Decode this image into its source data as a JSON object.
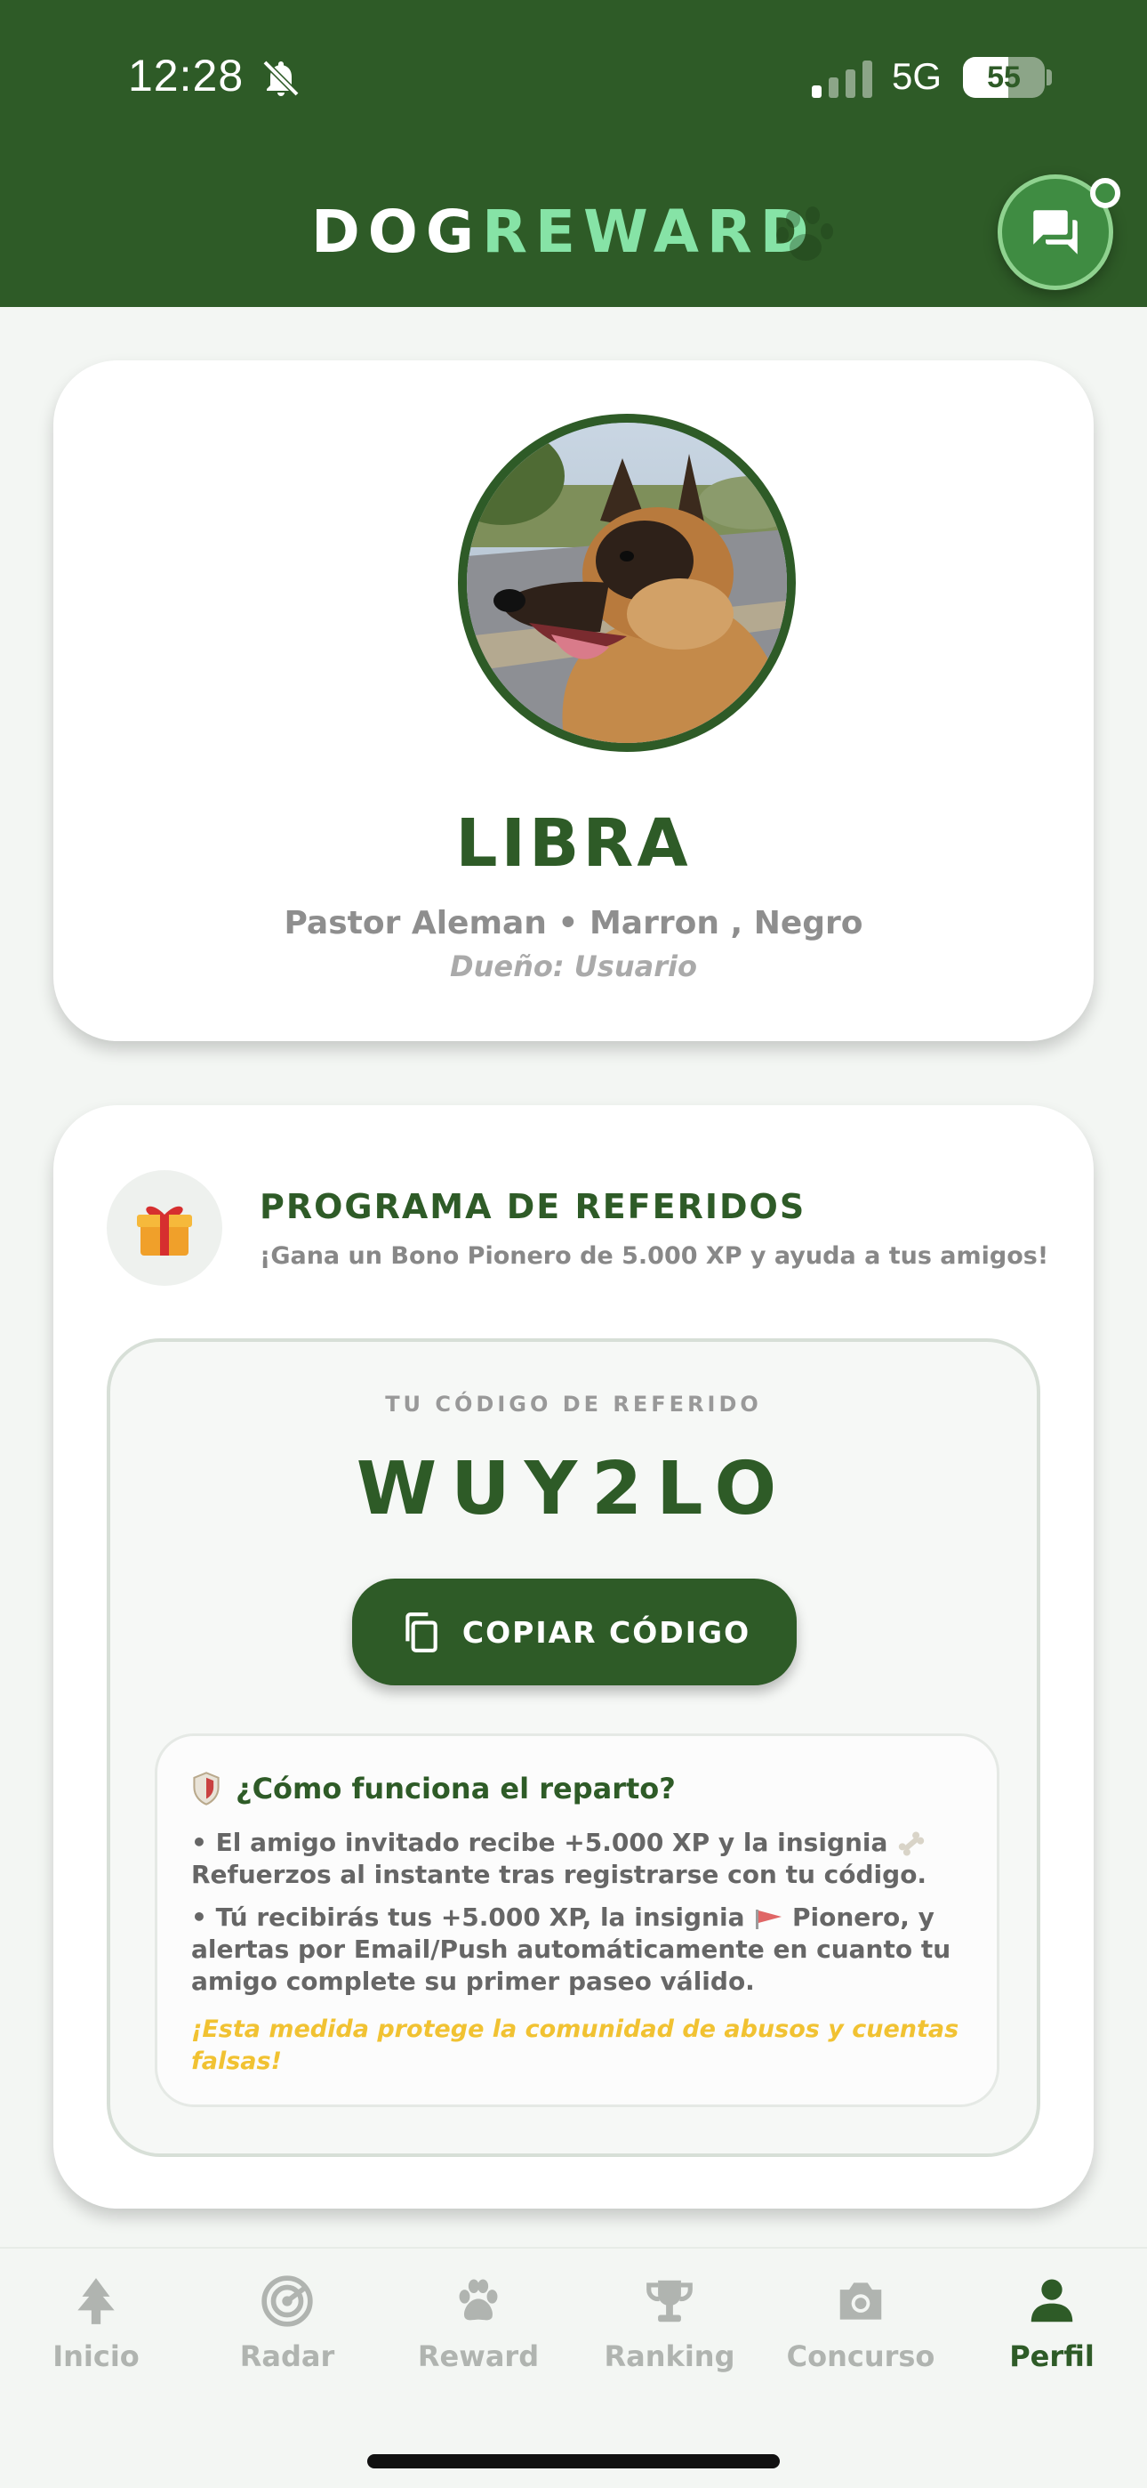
{
  "status_bar": {
    "time": "12:28",
    "network": "5G",
    "battery": "55",
    "battery_level": 0.55
  },
  "header": {
    "logo_part1": "DOG",
    "logo_part2": "REWARD"
  },
  "profile": {
    "name": "LIBRA",
    "breed_colors": "Pastor Aleman • Marron , Negro",
    "owner": "Dueño: Usuario"
  },
  "referral": {
    "title": "PROGRAMA DE REFERIDOS",
    "subtitle": "¡Gana un Bono Pionero de 5.000 XP y ayuda a tus amigos!",
    "code_label": "TU CÓDIGO DE REFERIDO",
    "code": "WUY2LO",
    "copy_label": "COPIAR CÓDIGO",
    "info_title": "¿Cómo funciona el reparto?",
    "info_p1_a": "• El amigo invitado recibe +5.000 XP y la insignia",
    "info_p1_b": "Refuerzos al instante tras registrarse con tu código.",
    "info_p2_a": "• Tú recibirás tus +5.000 XP, la insignia",
    "info_p2_b": "Pionero, y alertas por Email/Push automáticamente en cuanto tu amigo complete su primer paseo válido.",
    "warning": "¡Esta medida protege la comunidad de abusos y cuentas falsas!"
  },
  "nav": {
    "items": [
      {
        "label": "Inicio",
        "icon": "tree-icon"
      },
      {
        "label": "Radar",
        "icon": "radar-icon"
      },
      {
        "label": "Reward",
        "icon": "paw-icon"
      },
      {
        "label": "Ranking",
        "icon": "trophy-icon"
      },
      {
        "label": "Concurso",
        "icon": "camera-icon"
      },
      {
        "label": "Perfil",
        "icon": "person-icon"
      }
    ],
    "active": "Perfil"
  },
  "colors": {
    "brand_green": "#2e5b27",
    "accent_mint": "#86e3a6",
    "warning_yellow": "#f1c232",
    "inactive_gray": "#b0b4b0"
  }
}
